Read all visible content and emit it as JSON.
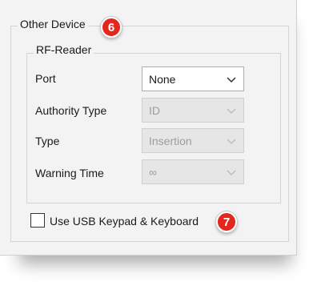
{
  "other_device": {
    "title": "Other Device",
    "badge": "6"
  },
  "rf_reader": {
    "title": "RF-Reader",
    "fields": [
      {
        "label": "Port",
        "value": "None",
        "enabled": true
      },
      {
        "label": "Authority Type",
        "value": "ID",
        "enabled": false
      },
      {
        "label": "Type",
        "value": "Insertion",
        "enabled": false
      },
      {
        "label": "Warning Time",
        "value": "∞",
        "enabled": false
      }
    ]
  },
  "usb_keypad": {
    "label": "Use USB Keypad & Keyboard",
    "checked": false,
    "badge": "7"
  },
  "colors": {
    "badge": "#e3261e",
    "panel_bg": "#f3f3f3",
    "disabled_bg": "#e6e6e6",
    "disabled_text": "#9d9d9d"
  },
  "icons": [
    "chevron-down-icon"
  ]
}
